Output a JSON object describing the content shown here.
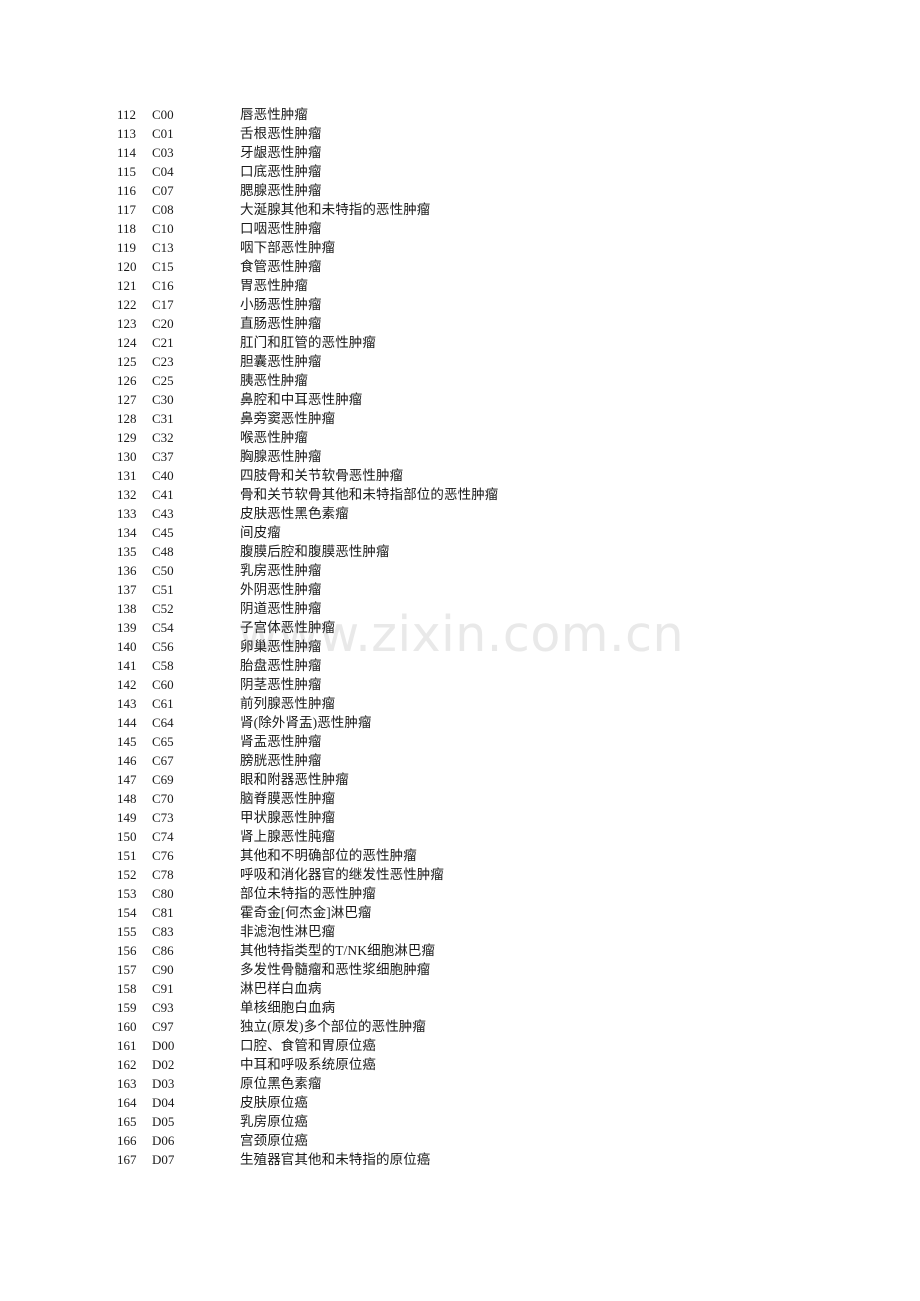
{
  "document": {
    "watermark": "www.zixin.com.cn",
    "watermark_color": "#e9e9e9",
    "text_color": "#1a1a1a",
    "background_color": "#ffffff"
  },
  "table": {
    "columns": [
      "index",
      "code",
      "description"
    ],
    "rows": [
      {
        "index": "112",
        "code": "C00",
        "description": "唇恶性肿瘤"
      },
      {
        "index": "113",
        "code": "C01",
        "description": "舌根恶性肿瘤"
      },
      {
        "index": "114",
        "code": "C03",
        "description": "牙龈恶性肿瘤"
      },
      {
        "index": "115",
        "code": "C04",
        "description": "口底恶性肿瘤"
      },
      {
        "index": "116",
        "code": "C07",
        "description": "腮腺恶性肿瘤"
      },
      {
        "index": "117",
        "code": "C08",
        "description": "大涎腺其他和未特指的恶性肿瘤"
      },
      {
        "index": "118",
        "code": "C10",
        "description": "口咽恶性肿瘤"
      },
      {
        "index": "119",
        "code": "C13",
        "description": "咽下部恶性肿瘤"
      },
      {
        "index": "120",
        "code": "C15",
        "description": "食管恶性肿瘤"
      },
      {
        "index": "121",
        "code": "C16",
        "description": "胃恶性肿瘤"
      },
      {
        "index": "122",
        "code": "C17",
        "description": "小肠恶性肿瘤"
      },
      {
        "index": "123",
        "code": "C20",
        "description": "直肠恶性肿瘤"
      },
      {
        "index": "124",
        "code": "C21",
        "description": "肛门和肛管的恶性肿瘤"
      },
      {
        "index": "125",
        "code": "C23",
        "description": "胆囊恶性肿瘤"
      },
      {
        "index": "126",
        "code": "C25",
        "description": "胰恶性肿瘤"
      },
      {
        "index": "127",
        "code": "C30",
        "description": "鼻腔和中耳恶性肿瘤"
      },
      {
        "index": "128",
        "code": "C31",
        "description": "鼻旁窦恶性肿瘤"
      },
      {
        "index": "129",
        "code": "C32",
        "description": "喉恶性肿瘤"
      },
      {
        "index": "130",
        "code": "C37",
        "description": "胸腺恶性肿瘤"
      },
      {
        "index": "131",
        "code": "C40",
        "description": "四肢骨和关节软骨恶性肿瘤"
      },
      {
        "index": "132",
        "code": "C41",
        "description": "骨和关节软骨其他和未特指部位的恶性肿瘤"
      },
      {
        "index": "133",
        "code": "C43",
        "description": "皮肤恶性黑色素瘤"
      },
      {
        "index": "134",
        "code": "C45",
        "description": "间皮瘤"
      },
      {
        "index": "135",
        "code": "C48",
        "description": "腹膜后腔和腹膜恶性肿瘤"
      },
      {
        "index": "136",
        "code": "C50",
        "description": "乳房恶性肿瘤"
      },
      {
        "index": "137",
        "code": "C51",
        "description": "外阴恶性肿瘤"
      },
      {
        "index": "138",
        "code": "C52",
        "description": "阴道恶性肿瘤"
      },
      {
        "index": "139",
        "code": "C54",
        "description": "子宫体恶性肿瘤"
      },
      {
        "index": "140",
        "code": "C56",
        "description": "卵巢恶性肿瘤"
      },
      {
        "index": "141",
        "code": "C58",
        "description": "胎盘恶性肿瘤"
      },
      {
        "index": "142",
        "code": "C60",
        "description": "阴茎恶性肿瘤"
      },
      {
        "index": "143",
        "code": "C61",
        "description": "前列腺恶性肿瘤"
      },
      {
        "index": "144",
        "code": "C64",
        "description": "肾(除外肾盂)恶性肿瘤"
      },
      {
        "index": "145",
        "code": "C65",
        "description": "肾盂恶性肿瘤"
      },
      {
        "index": "146",
        "code": "C67",
        "description": "膀胱恶性肿瘤"
      },
      {
        "index": "147",
        "code": "C69",
        "description": "眼和附器恶性肿瘤"
      },
      {
        "index": "148",
        "code": "C70",
        "description": "脑脊膜恶性肿瘤"
      },
      {
        "index": "149",
        "code": "C73",
        "description": "甲状腺恶性肿瘤"
      },
      {
        "index": "150",
        "code": "C74",
        "description": "肾上腺恶性肫瘤"
      },
      {
        "index": "151",
        "code": "C76",
        "description": "其他和不明确部位的恶性肿瘤"
      },
      {
        "index": "152",
        "code": "C78",
        "description": "呼吸和消化器官的继发性恶性肿瘤"
      },
      {
        "index": "153",
        "code": "C80",
        "description": "部位未特指的恶性肿瘤"
      },
      {
        "index": "154",
        "code": "C81",
        "description": "霍奇金[何杰金]淋巴瘤"
      },
      {
        "index": "155",
        "code": "C83",
        "description": "非滤泡性淋巴瘤"
      },
      {
        "index": "156",
        "code": "C86",
        "description": "其他特指类型的T/NK细胞淋巴瘤"
      },
      {
        "index": "157",
        "code": "C90",
        "description": "多发性骨髓瘤和恶性浆细胞肿瘤"
      },
      {
        "index": "158",
        "code": "C91",
        "description": "淋巴样白血病"
      },
      {
        "index": "159",
        "code": "C93",
        "description": "单核细胞白血病"
      },
      {
        "index": "160",
        "code": "C97",
        "description": "独立(原发)多个部位的恶性肿瘤"
      },
      {
        "index": "161",
        "code": "D00",
        "description": "口腔、食管和胃原位癌"
      },
      {
        "index": "162",
        "code": "D02",
        "description": "中耳和呼吸系统原位癌"
      },
      {
        "index": "163",
        "code": "D03",
        "description": "原位黑色素瘤"
      },
      {
        "index": "164",
        "code": "D04",
        "description": "皮肤原位癌"
      },
      {
        "index": "165",
        "code": "D05",
        "description": "乳房原位癌"
      },
      {
        "index": "166",
        "code": "D06",
        "description": "宫颈原位癌"
      },
      {
        "index": "167",
        "code": "D07",
        "description": "生殖器官其他和未特指的原位癌"
      }
    ]
  }
}
